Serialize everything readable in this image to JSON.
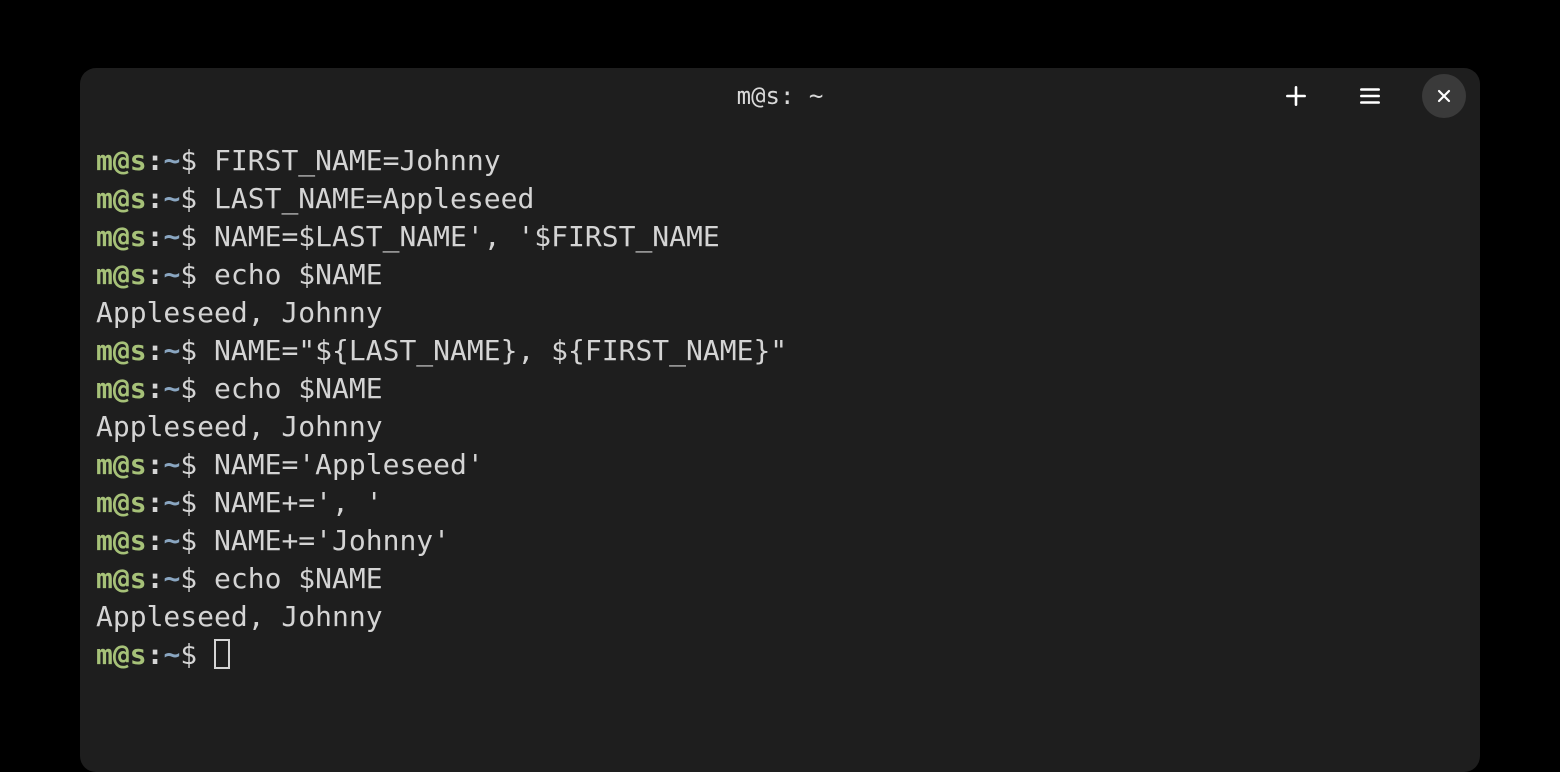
{
  "window": {
    "title": "m@s: ~"
  },
  "prompt": {
    "user_host": "m@s",
    "colon": ":",
    "path": "~",
    "symbol": "$"
  },
  "lines": [
    {
      "type": "cmd",
      "text": "FIRST_NAME=Johnny"
    },
    {
      "type": "cmd",
      "text": "LAST_NAME=Appleseed"
    },
    {
      "type": "cmd",
      "text": "NAME=$LAST_NAME', '$FIRST_NAME"
    },
    {
      "type": "cmd",
      "text": "echo $NAME"
    },
    {
      "type": "out",
      "text": "Appleseed, Johnny"
    },
    {
      "type": "cmd",
      "text": "NAME=\"${LAST_NAME}, ${FIRST_NAME}\""
    },
    {
      "type": "cmd",
      "text": "echo $NAME"
    },
    {
      "type": "out",
      "text": "Appleseed, Johnny"
    },
    {
      "type": "cmd",
      "text": "NAME='Appleseed'"
    },
    {
      "type": "cmd",
      "text": "NAME+=', '"
    },
    {
      "type": "cmd",
      "text": "NAME+='Johnny'"
    },
    {
      "type": "cmd",
      "text": "echo $NAME"
    },
    {
      "type": "out",
      "text": "Appleseed, Johnny"
    },
    {
      "type": "cursor"
    }
  ],
  "colors": {
    "bg": "#000000",
    "term_bg": "#1e1e1e",
    "text": "#d4d4d4",
    "user_host": "#a6c178",
    "path": "#8aa6c1"
  }
}
